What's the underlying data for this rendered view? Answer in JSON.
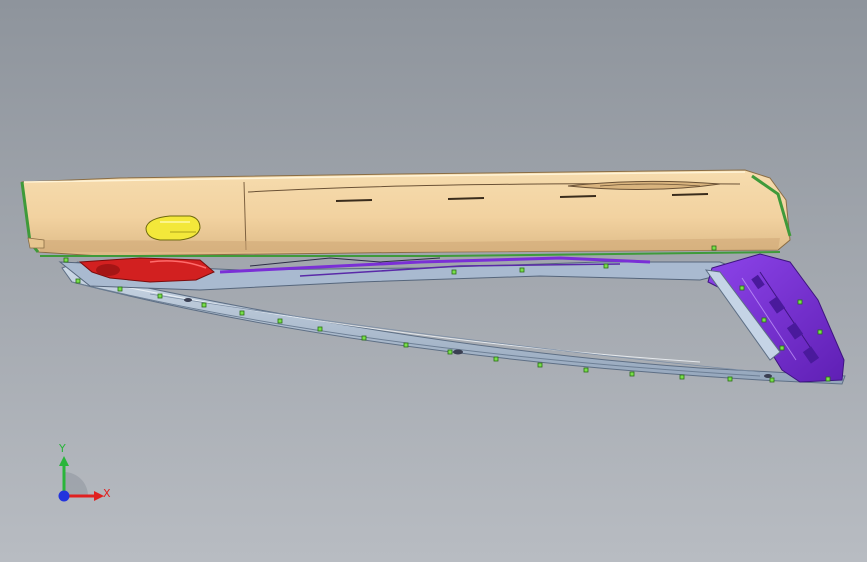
{
  "viewport": {
    "background_top": "#8e949c",
    "background_bottom": "#b8bcc2"
  },
  "model": {
    "colors": {
      "trim_body": "#f2d2a0",
      "trim_shadow": "#d9b47e",
      "trim_edge_green": "#3f9a3a",
      "button_yellow": "#f3e83a",
      "motor_red": "#d22020",
      "bracket_purple": "#7a2fd6",
      "rail_blue": "#b9c9dc",
      "rail_dark": "#6d7f95",
      "clip_green": "#78e04a"
    }
  },
  "triad": {
    "x_label": "X",
    "y_label": "Y",
    "x_color": "#e02020",
    "y_color": "#29b53a",
    "z_color": "#2233dd"
  }
}
